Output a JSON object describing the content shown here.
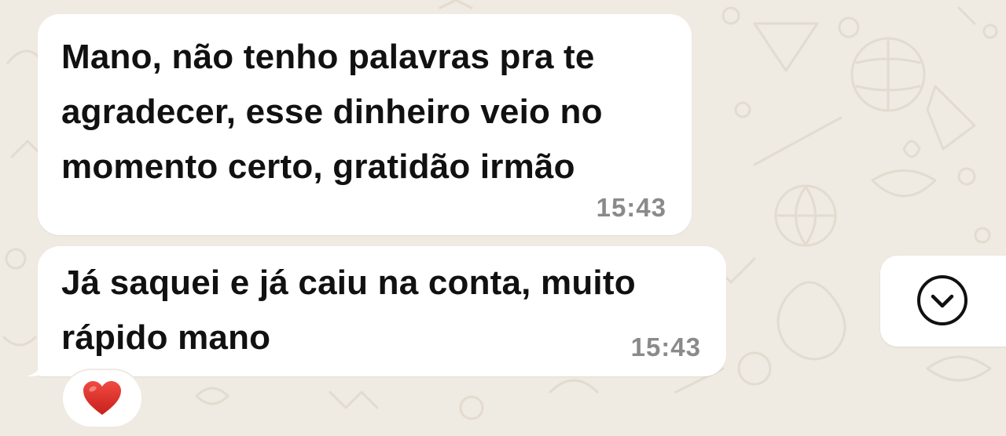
{
  "colors": {
    "wallpaper": "#efeae2",
    "bubble": "#ffffff",
    "text": "#111111",
    "timestamp": "#8a8a8a",
    "heart": "#e0312b"
  },
  "messages": [
    {
      "text": "Mano, não tenho palavras pra te\nagradecer, esse dinheiro veio no\nmomento certo, gratidão irmão",
      "time": "15:43"
    },
    {
      "text": "Já saquei e já caiu na conta, muito\nrápido mano",
      "time": "15:43",
      "reaction": "heart-emoji"
    }
  ],
  "scroll_button": {
    "icon": "chevron-down-circle-icon"
  }
}
